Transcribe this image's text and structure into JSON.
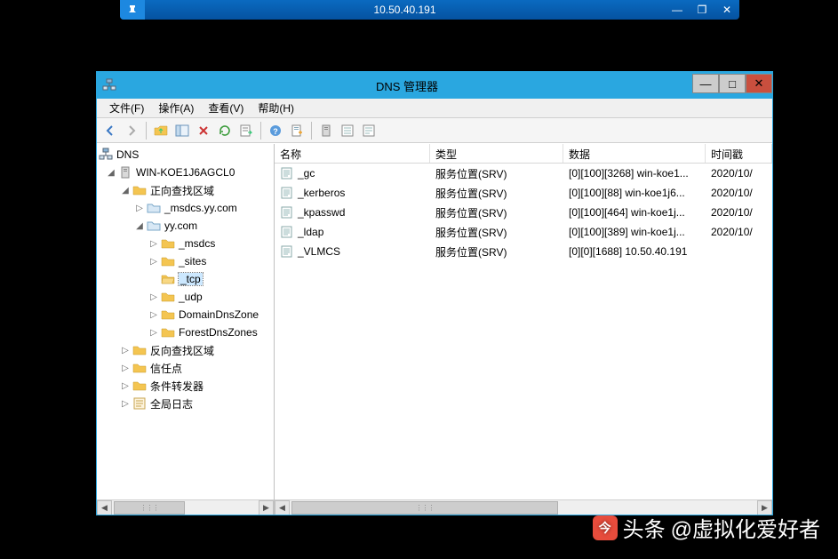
{
  "rdp": {
    "ip": "10.50.40.191"
  },
  "window": {
    "title": "DNS 管理器"
  },
  "menu": {
    "file": "文件(F)",
    "action": "操作(A)",
    "view": "查看(V)",
    "help": "帮助(H)"
  },
  "tree": {
    "root": "DNS",
    "server": "WIN-KOE1J6AGCL0",
    "fwd_zones": "正向查找区域",
    "zone_msdcs": "_msdcs.yy.com",
    "zone_yy": "yy.com",
    "n_msdcs": "_msdcs",
    "n_sites": "_sites",
    "n_tcp": "_tcp",
    "n_udp": "_udp",
    "n_ddz": "DomainDnsZone",
    "n_fdz": "ForestDnsZones",
    "rev_zones": "反向查找区域",
    "trust": "信任点",
    "cond_fwd": "条件转发器",
    "global_log": "全局日志"
  },
  "columns": {
    "name": "名称",
    "type": "类型",
    "data": "数据",
    "timestamp": "时间戳"
  },
  "col_widths": {
    "name": 175,
    "type": 150,
    "data": 160,
    "timestamp": 75
  },
  "records": [
    {
      "name": "_gc",
      "type": "服务位置(SRV)",
      "data": "[0][100][3268] win-koe1...",
      "ts": "2020/10/"
    },
    {
      "name": "_kerberos",
      "type": "服务位置(SRV)",
      "data": "[0][100][88] win-koe1j6...",
      "ts": "2020/10/"
    },
    {
      "name": "_kpasswd",
      "type": "服务位置(SRV)",
      "data": "[0][100][464] win-koe1j...",
      "ts": "2020/10/"
    },
    {
      "name": "_ldap",
      "type": "服务位置(SRV)",
      "data": "[0][100][389] win-koe1j...",
      "ts": "2020/10/"
    },
    {
      "name": "_VLMCS",
      "type": "服务位置(SRV)",
      "data": "[0][0][1688] 10.50.40.191",
      "ts": ""
    }
  ],
  "watermark": {
    "prefix": "头条",
    "author": "@虚拟化爱好者"
  }
}
